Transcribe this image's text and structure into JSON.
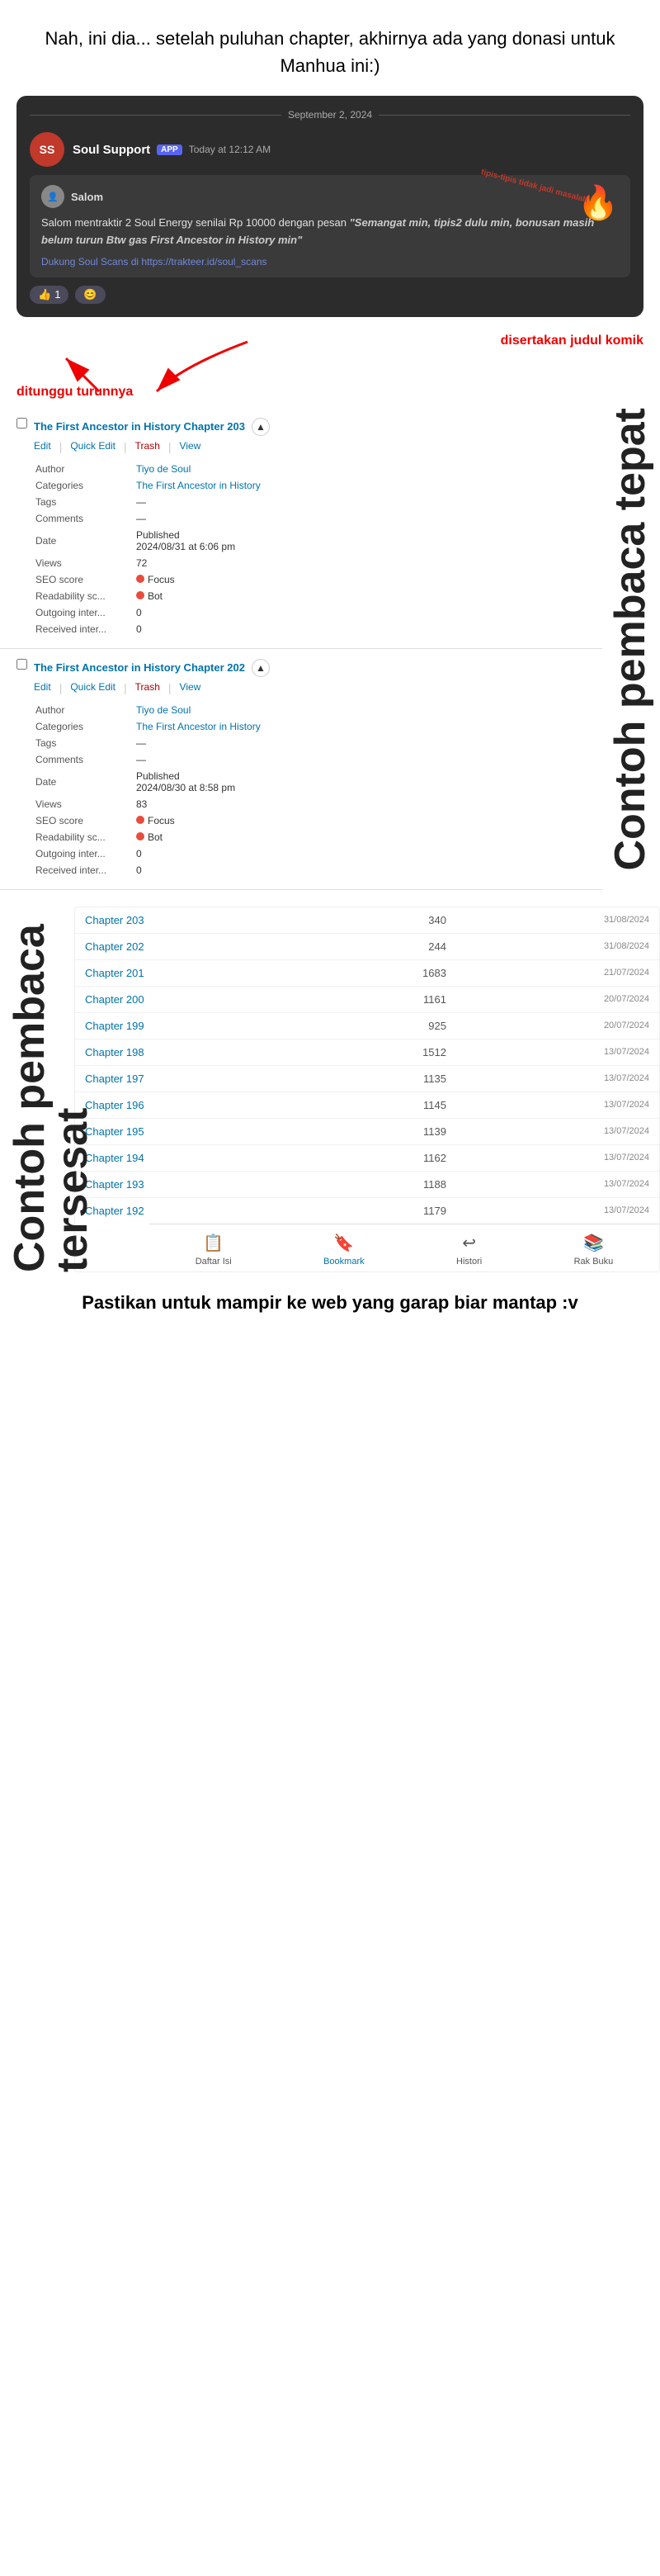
{
  "top_text": "Nah, ini dia... setelah puluhan chapter, akhirnya ada yang donasi untuk Manhua ini:)",
  "discord": {
    "date": "September 2, 2024",
    "channel_name": "Soul Support",
    "app_badge": "APP",
    "time": "Today at 12:12 AM",
    "avatar_text": "SS",
    "message_user": "Salom",
    "message_body_1": "Salom mentraktir 2 Soul Energy senilai Rp 10000 dengan pesan",
    "message_quote": "\"Semangat min, tipis2 dulu min, bonusan masih belum turun Btw gas First Ancestor in History min\"",
    "fire_emoji": "🔥",
    "support_text": "Dukung Soul Scans di https://trakteer.id/soul_scans",
    "tipis_annotation": "tipis-tipis tidak jadi masalah",
    "reaction_1": "1",
    "reaction_emoji_1": "👍",
    "reaction_emoji_2": "😊"
  },
  "annotation_right": "disertakan judul komik",
  "annotation_left": "ditunggu turunnya",
  "sidebar_label_right": "Contoh pembaca tepat",
  "posts": [
    {
      "title": "The First Ancestor in History Chapter 203",
      "actions": {
        "edit": "Edit",
        "quick_edit": "Quick Edit",
        "trash": "Trash",
        "view": "View"
      },
      "author": "Tiyo de Soul",
      "categories": "The First Ancestor in History",
      "tags": "—",
      "comments": "—",
      "date_label": "Published",
      "date_value": "2024/08/31 at 6:06 pm",
      "views": "72",
      "seo_score": "Focus",
      "readability": "Bot",
      "outgoing_inter": "0",
      "received_inter": "0",
      "arrow": "▲"
    },
    {
      "title": "The First Ancestor in History Chapter 202",
      "actions": {
        "edit": "Edit",
        "quick_edit": "Quick Edit",
        "trash": "Trash",
        "view": "View"
      },
      "author": "Tiyo de Soul",
      "categories": "The First Ancestor in History",
      "tags": "—",
      "comments": "—",
      "date_label": "Published",
      "date_value": "2024/08/30 at 8:58 pm",
      "views": "83",
      "seo_score": "Focus",
      "readability": "Bot",
      "outgoing_inter": "0",
      "received_inter": "0",
      "arrow": "▲"
    }
  ],
  "sidebar_label_left": "Contoh pembaca tersesat",
  "chapters": [
    {
      "title": "Chapter 203",
      "views": "340",
      "date": "31/08/2024"
    },
    {
      "title": "Chapter 202",
      "views": "244",
      "date": "31/08/2024"
    },
    {
      "title": "Chapter 201",
      "views": "1683",
      "date": "21/07/2024"
    },
    {
      "title": "Chapter 200",
      "views": "1161",
      "date": "20/07/2024"
    },
    {
      "title": "Chapter 199",
      "views": "925",
      "date": "20/07/2024"
    },
    {
      "title": "Chapter 198",
      "views": "1512",
      "date": "13/07/2024"
    },
    {
      "title": "Chapter 197",
      "views": "1135",
      "date": "13/07/2024"
    },
    {
      "title": "Chapter 196",
      "views": "1145",
      "date": "13/07/2024"
    },
    {
      "title": "Chapter 195",
      "views": "1139",
      "date": "13/07/2024"
    },
    {
      "title": "Chapter 194",
      "views": "1162",
      "date": "13/07/2024"
    },
    {
      "title": "Chapter 193",
      "views": "1188",
      "date": "13/07/2024"
    },
    {
      "title": "Chapter 192",
      "views": "1179",
      "date": "13/07/2024"
    }
  ],
  "bottom_nav": [
    {
      "icon": "📋",
      "label": "Daftar Isi",
      "active": false
    },
    {
      "icon": "🔖",
      "label": "Bookmark",
      "active": true
    },
    {
      "icon": "↩",
      "label": "Histori",
      "active": false
    },
    {
      "icon": "📚",
      "label": "Rak Buku",
      "active": false
    }
  ],
  "bottom_text": "Pastikan untuk mampir ke web yang garap biar mantap :v",
  "meta_labels": {
    "author": "Author",
    "categories": "Categories",
    "tags": "Tags",
    "comments": "Comments",
    "date": "Date",
    "views": "Views",
    "seo_score": "SEO score",
    "readability": "Readability sc...",
    "outgoing": "Outgoing inter...",
    "received": "Received inter..."
  }
}
